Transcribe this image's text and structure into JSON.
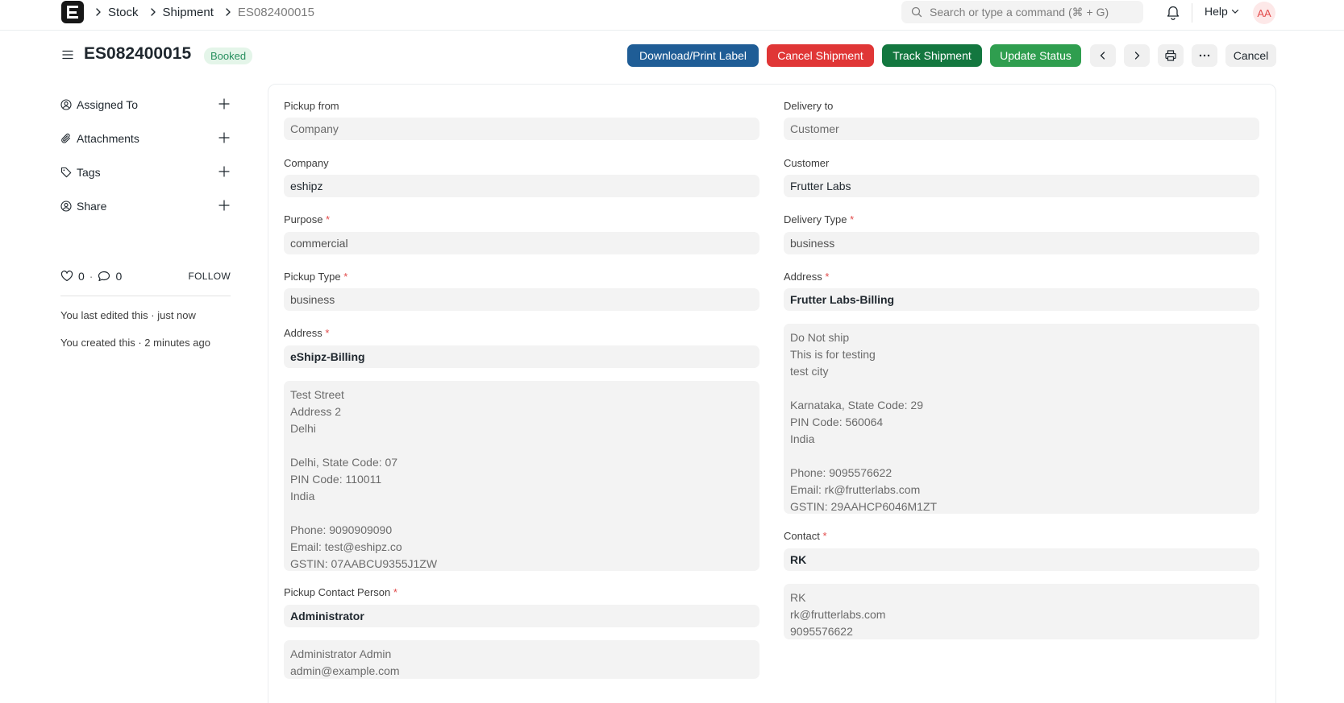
{
  "navbar": {
    "breadcrumbs": [
      "Stock",
      "Shipment",
      "ES082400015"
    ],
    "search_placeholder": "Search or type a command (⌘ + G)",
    "help_label": "Help",
    "avatar_initials": "AA"
  },
  "page": {
    "title": "ES082400015",
    "status": "Booked",
    "actions": {
      "download_label": "Download/Print Label",
      "cancel_shipment_label": "Cancel Shipment",
      "track_label": "Track Shipment",
      "update_status_label": "Update Status",
      "cancel_label": "Cancel"
    }
  },
  "sidebar": {
    "items": [
      {
        "label": "Assigned To",
        "icon": "assign-user-icon"
      },
      {
        "label": "Attachments",
        "icon": "paperclip-icon"
      },
      {
        "label": "Tags",
        "icon": "tag-icon"
      },
      {
        "label": "Share",
        "icon": "share-user-icon"
      }
    ],
    "likes": "0",
    "comments": "0",
    "follow_label": "FOLLOW",
    "last_edited": "You last edited this · just now",
    "created": "You created this · 2 minutes ago"
  },
  "form": {
    "pickup": {
      "pickup_from_label": "Pickup from",
      "pickup_from_value": "Company",
      "company_label": "Company",
      "company_value": "eshipz",
      "purpose_label": "Purpose",
      "purpose_value": "commercial",
      "pickup_type_label": "Pickup Type",
      "pickup_type_value": "business",
      "address_label": "Address",
      "address_value": "eShipz-Billing",
      "address_lines": [
        "Test Street",
        "Address 2",
        "Delhi",
        "",
        "Delhi, State Code: 07",
        "PIN Code: 110011",
        "India",
        "",
        "Phone: 9090909090",
        "Email: test@eshipz.co",
        "GSTIN: 07AABCU9355J1ZW"
      ],
      "contact_person_label": "Pickup Contact Person",
      "contact_person_value": "Administrator",
      "contact_person_lines": [
        "Administrator Admin",
        "admin@example.com"
      ]
    },
    "delivery": {
      "delivery_to_label": "Delivery to",
      "delivery_to_value": "Customer",
      "customer_label": "Customer",
      "customer_value": "Frutter Labs",
      "delivery_type_label": "Delivery Type",
      "delivery_type_value": "business",
      "address_label": "Address",
      "address_value": "Frutter Labs-Billing",
      "address_lines": [
        "Do Not ship",
        "This is for testing",
        "test city",
        "",
        "Karnataka, State Code: 29",
        "PIN Code: 560064",
        "India",
        "",
        "Phone: 9095576622",
        "Email: rk@frutterlabs.com",
        "GSTIN: 29AAHCP6046M1ZT"
      ],
      "contact_label": "Contact",
      "contact_value": "RK",
      "contact_lines": [
        "RK",
        "rk@frutterlabs.com",
        "9095576622"
      ]
    }
  },
  "required_marker": "*"
}
